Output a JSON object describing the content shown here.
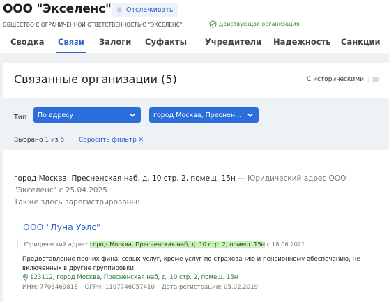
{
  "company": {
    "title": "ООО \"Экселенс\"",
    "full_name": "ОБЩЕСТВО С ОГРАНИЧЕННОЙ ОТВЕТСТВЕННОСТЬЮ \"ЭКСЕЛЕНС\"",
    "status": "Действующая организация"
  },
  "track_button": {
    "label": "Отслеживать",
    "icon": "bell-icon"
  },
  "tabs": [
    {
      "label": "Сводка"
    },
    {
      "label": "Связи",
      "active": true
    },
    {
      "label": "Залоги"
    },
    {
      "label": "Суфакты"
    },
    {
      "label": "Учредители"
    },
    {
      "label": "Надежность"
    },
    {
      "label": "Санкции"
    }
  ],
  "section": {
    "title": "Связанные организации (5)",
    "historical_label": "С историческими"
  },
  "filter": {
    "type_label": "Тип",
    "type_value": "По адресу",
    "address_value": "город Москва, Преснен...",
    "selected_prefix": "Выбрано",
    "selected_count": "1",
    "selected_of": "из",
    "selected_total": "5",
    "reset_label": "Сбросить фильтр ✕"
  },
  "address_group": {
    "address": "город Москва, Пресненская наб, д. 10 стр. 2, помещ. 15н",
    "note": " — Юридический адрес ООО \"Экселенс\" с 25.04.2025",
    "also_registered": "Также здесь зарегистрированы:"
  },
  "related_org": {
    "name": "ООО \"Луна Уэлс\"",
    "legal_label": "Юридический адрес: ",
    "legal_address": "город Москва, Пресненская наб, д. 10 стр. 2, помещ. 15н",
    "legal_since": " с 18.06.2021",
    "activity": "Предоставление прочих финансовых услуг, кроме услуг по страхованию и пенсионному обеспечению, не включенных в другие группировки",
    "location": "123112, город Москва, Пресненская наб, д. 10 стр. 2, помещ. 15н",
    "inn": "ИНН: 7703469818",
    "ogrn": "ОГРН: 1197746057410",
    "reg_date": "Дата регистрации: 05.02.2019"
  },
  "colors": {
    "accent": "#2961c9",
    "select_bg": "#2b6edb",
    "status_green": "#3c8a3a",
    "highlight": "#c8f3b8"
  }
}
